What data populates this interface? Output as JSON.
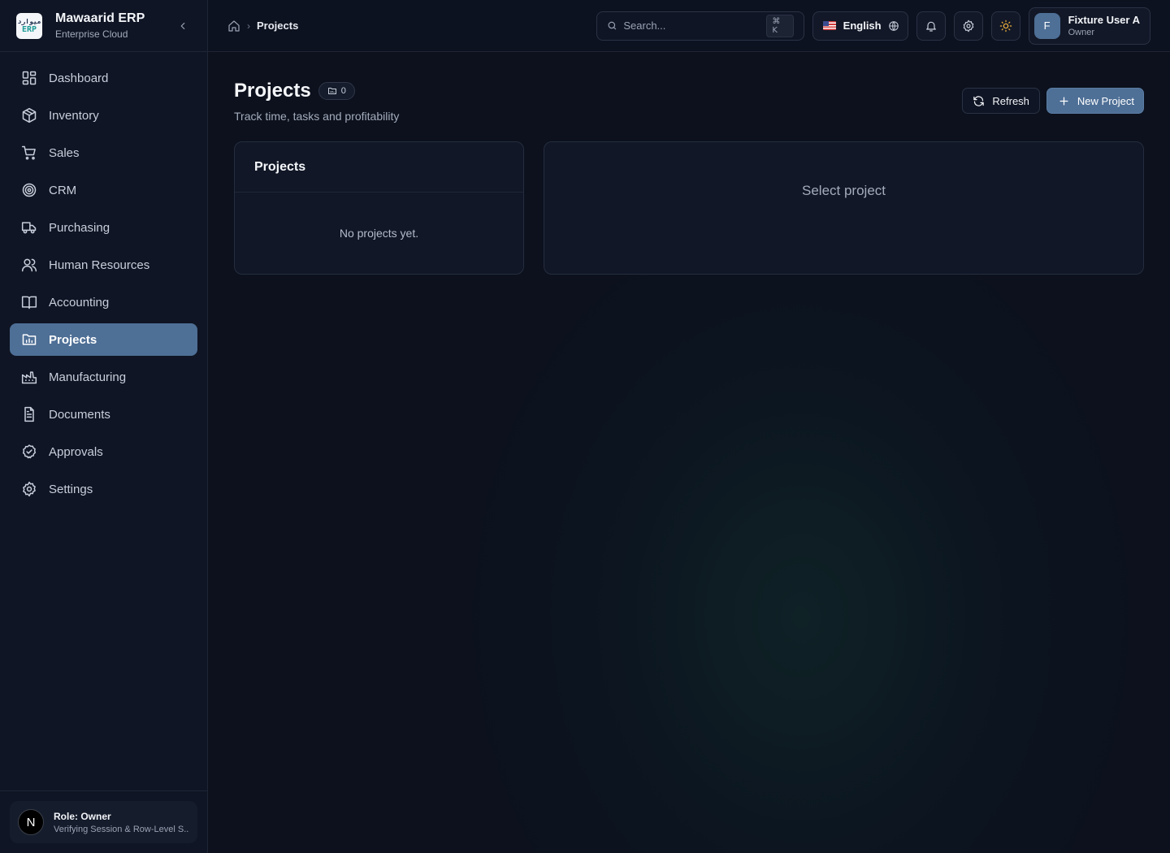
{
  "brand": {
    "logo_top": "ميوارد",
    "logo_bottom": "ERP",
    "name": "Mawaarid ERP",
    "subtitle": "Enterprise Cloud"
  },
  "sidebar": {
    "items": [
      {
        "label": "Dashboard",
        "icon": "grid-icon"
      },
      {
        "label": "Inventory",
        "icon": "package-icon"
      },
      {
        "label": "Sales",
        "icon": "cart-icon"
      },
      {
        "label": "CRM",
        "icon": "target-icon"
      },
      {
        "label": "Purchasing",
        "icon": "truck-icon"
      },
      {
        "label": "Human Resources",
        "icon": "users-icon"
      },
      {
        "label": "Accounting",
        "icon": "book-icon"
      },
      {
        "label": "Projects",
        "icon": "folder-chart-icon",
        "active": true
      },
      {
        "label": "Manufacturing",
        "icon": "factory-icon"
      },
      {
        "label": "Documents",
        "icon": "file-text-icon"
      },
      {
        "label": "Approvals",
        "icon": "check-circle-icon"
      },
      {
        "label": "Settings",
        "icon": "gear-icon"
      }
    ],
    "role": {
      "avatar": "N",
      "title": "Role: Owner",
      "subtitle": "Verifying Session & Row-Level S..."
    }
  },
  "topbar": {
    "breadcrumb_current": "Projects",
    "search_placeholder": "Search...",
    "search_shortcut": "⌘ K",
    "language": "English",
    "user": {
      "initial": "F",
      "name": "Fixture User A",
      "role": "Owner"
    }
  },
  "page": {
    "title": "Projects",
    "count": "0",
    "subtitle": "Track time, tasks and profitability",
    "refresh_label": "Refresh",
    "new_label": "New Project"
  },
  "projects_card": {
    "title": "Projects",
    "empty": "No projects yet."
  },
  "detail_card": {
    "placeholder": "Select project"
  },
  "colors": {
    "accent": "#4e6f96",
    "background": "#0c111d",
    "sidebar": "#0f1524",
    "sun": "#f3b33d"
  }
}
